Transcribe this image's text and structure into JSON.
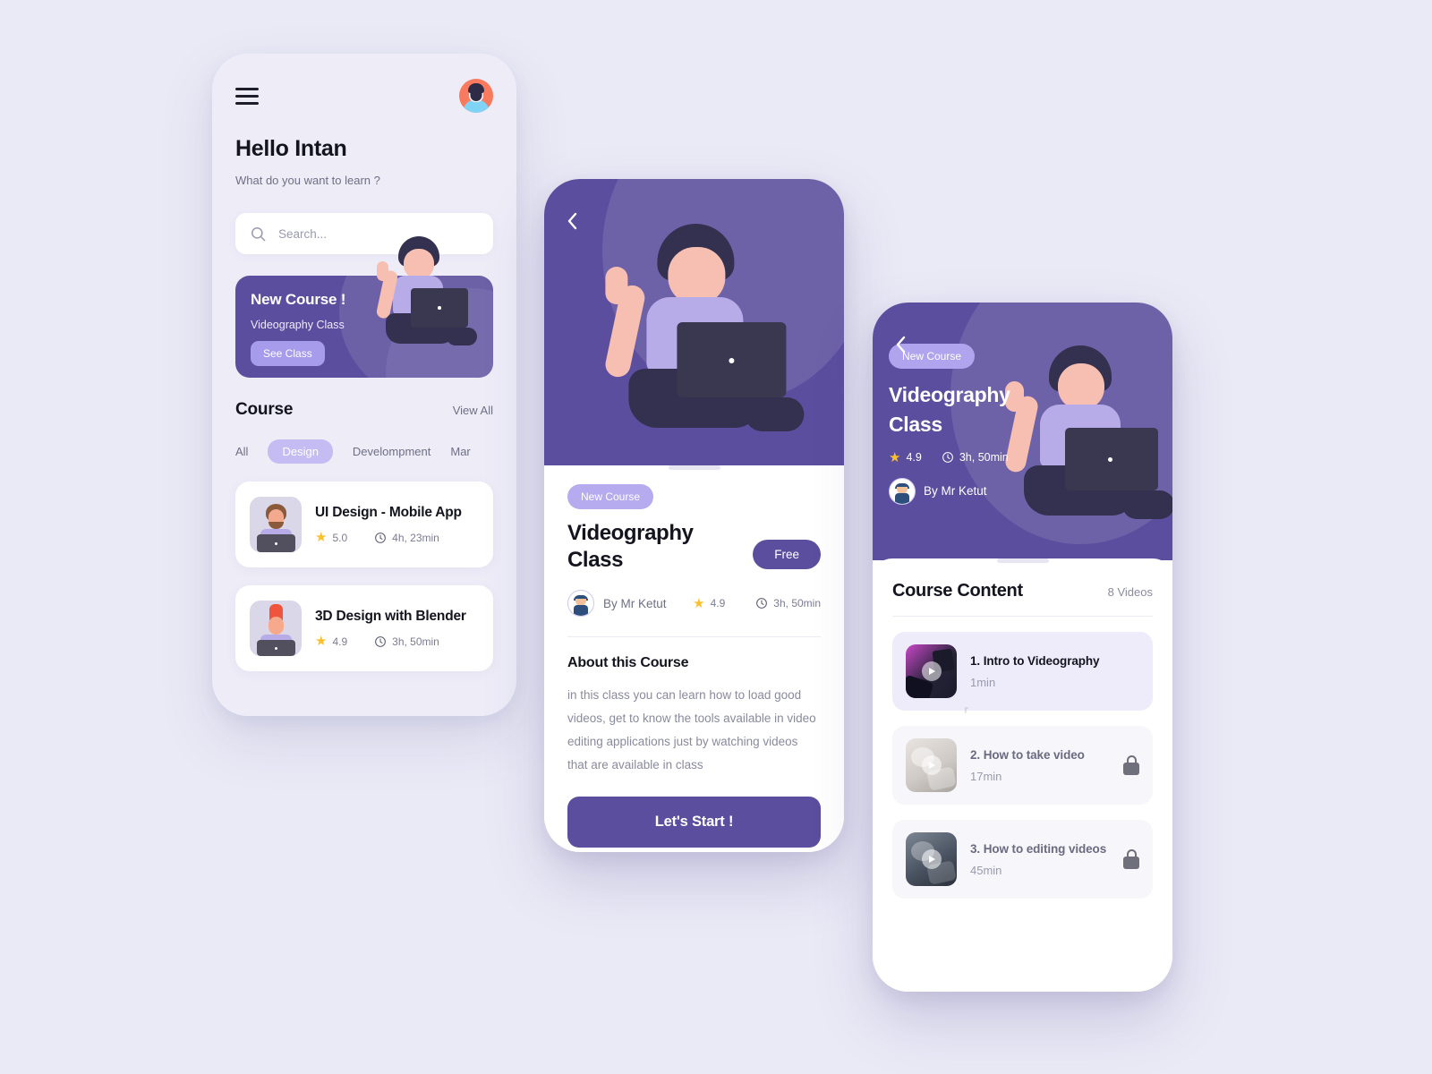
{
  "home": {
    "menu_icon": "hamburger-menu-icon",
    "avatar_icon": "user-avatar",
    "greeting": "Hello Intan",
    "subtitle": "What do you want to learn ?",
    "search": {
      "placeholder": "Search...",
      "value": "",
      "icon": "search-icon"
    },
    "banner": {
      "title": "New Course !",
      "subtitle": "Videography Class",
      "cta": "See Class",
      "bg_color": "#5c4e9e",
      "cta_color": "#a79bec"
    },
    "section": {
      "title": "Course",
      "view_all": "View All"
    },
    "tabs": [
      {
        "label": "All",
        "active": false
      },
      {
        "label": "Design",
        "active": true
      },
      {
        "label": "Develompment",
        "active": false
      },
      {
        "label": "Mar",
        "active": false
      }
    ],
    "courses": [
      {
        "name": "UI Design - Mobile App",
        "rating": "5.0",
        "duration": "4h, 23min"
      },
      {
        "name": "3D Design with Blender",
        "rating": "4.9",
        "duration": "3h, 50min"
      }
    ]
  },
  "detail": {
    "back_icon": "chevron-left-icon",
    "badge": "New Course",
    "title": "Videography\nClass",
    "title_line1": "Videography",
    "title_line2": "Class",
    "price_badge": "Free",
    "author": "By Mr Ketut",
    "rating": "4.9",
    "duration": "3h, 50min",
    "about_title": "About this Course",
    "about_body": "in this class you can learn how to load good videos, get to know the tools available in video editing applications just by watching videos that are available in class",
    "start_button": "Let's Start !"
  },
  "content": {
    "back_icon": "chevron-left-icon",
    "badge": "New Course",
    "title_line1": "Videography",
    "title_line2": "Class",
    "rating": "4.9",
    "duration": "3h, 50min",
    "author": "By Mr Ketut",
    "section_title": "Course Content",
    "video_count": "8 Videos",
    "ghost_text": "r",
    "videos": [
      {
        "name": "1. Intro to Videography",
        "duration": "1min",
        "locked": false
      },
      {
        "name": "2. How to take video",
        "duration": "17min",
        "locked": true
      },
      {
        "name": "3. How to editing videos",
        "duration": "45min",
        "locked": true
      }
    ]
  },
  "colors": {
    "background": "#eaeaf6",
    "primary": "#5c4e9e",
    "accent_light": "#b7abf0",
    "star": "#fbc02d"
  }
}
